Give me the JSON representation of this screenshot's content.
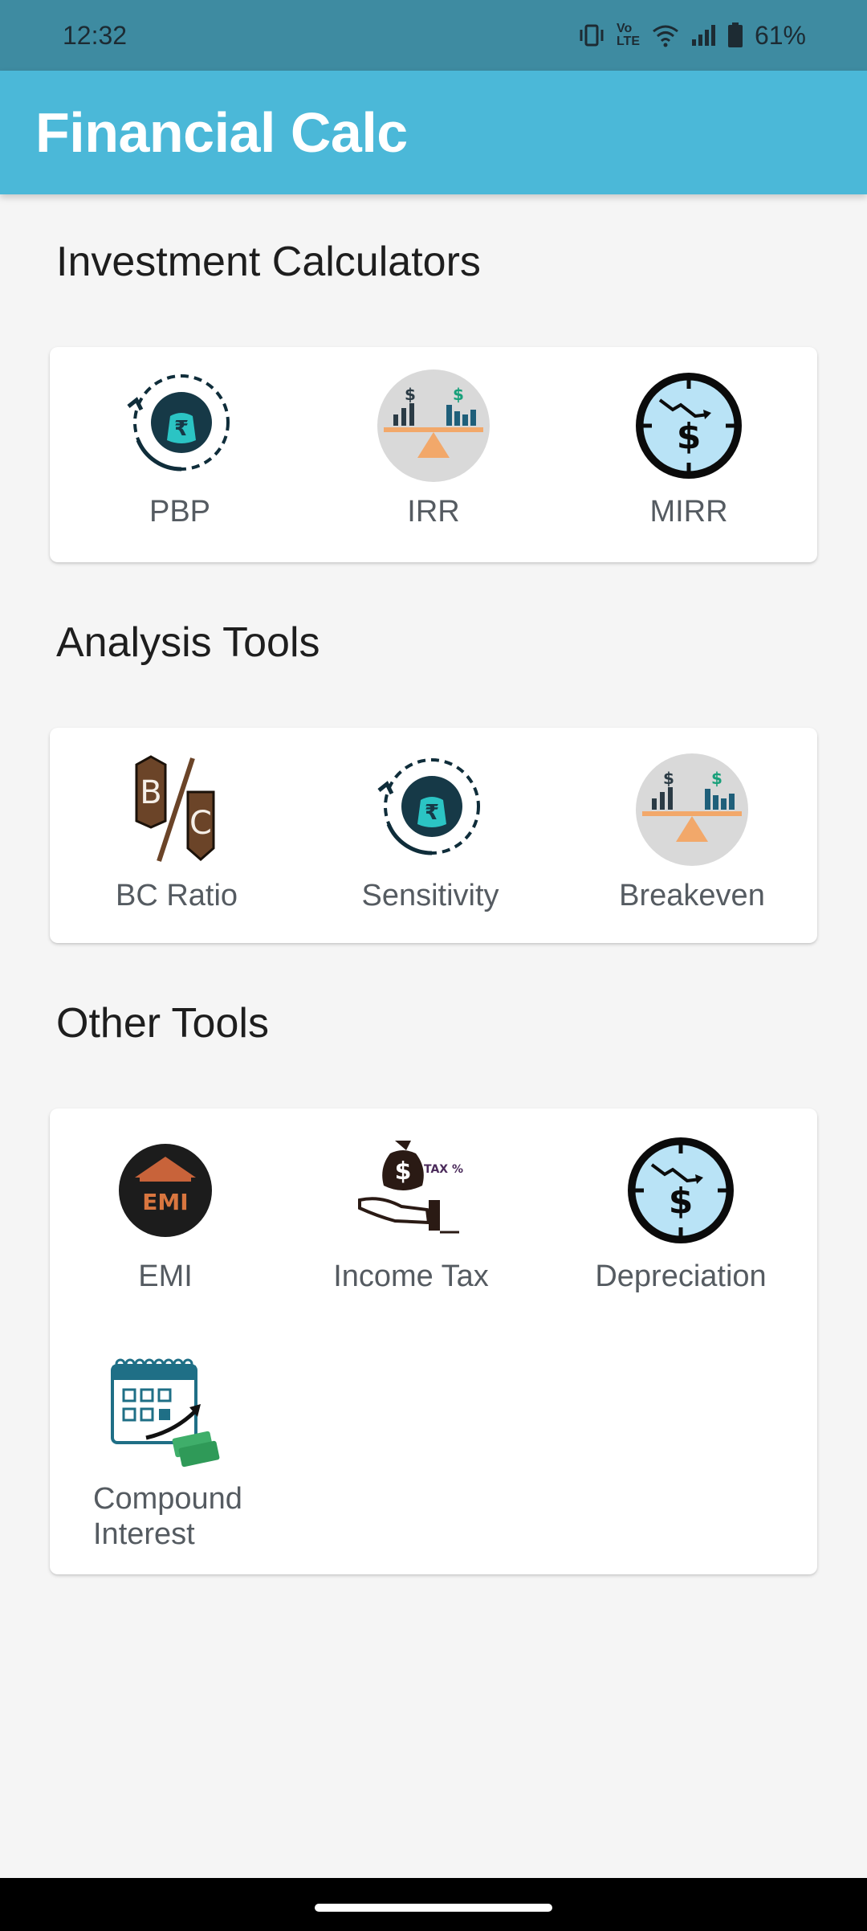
{
  "status_bar": {
    "time": "12:32",
    "network_label": "Vo LTE",
    "battery": "61%"
  },
  "app_bar": {
    "title": "Financial Calc"
  },
  "sections": [
    {
      "title": "Investment Calculators",
      "items": [
        {
          "label": "PBP",
          "icon": "money-bag-cycle-icon"
        },
        {
          "label": "IRR",
          "icon": "balance-chart-icon"
        },
        {
          "label": "MIRR",
          "icon": "dollar-dial-icon"
        }
      ]
    },
    {
      "title": "Analysis Tools",
      "items": [
        {
          "label": "BC Ratio",
          "icon": "bc-ratio-icon"
        },
        {
          "label": "Sensitivity",
          "icon": "money-bag-cycle-icon"
        },
        {
          "label": "Breakeven",
          "icon": "balance-chart-icon"
        }
      ]
    },
    {
      "title": "Other Tools",
      "items": [
        {
          "label": "EMI",
          "icon": "emi-house-icon"
        },
        {
          "label": "Income Tax",
          "icon": "income-tax-icon",
          "tax_text": "TAX %"
        },
        {
          "label": "Depreciation",
          "icon": "dollar-dial-icon"
        },
        {
          "label": "Compound Interest",
          "icon": "calendar-money-icon"
        }
      ]
    }
  ],
  "colors": {
    "status_bar": "#3e8ba1",
    "app_bar": "#4bb8d8",
    "background": "#f5f5f5",
    "card": "#ffffff",
    "label": "#555b61"
  }
}
